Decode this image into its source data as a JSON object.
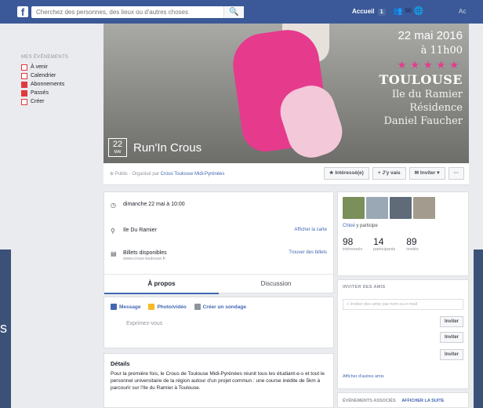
{
  "topbar": {
    "logo": "f",
    "search_placeholder": "Cherchez des personnes, des lieux ou d'autres choses",
    "search_icon": "🔍",
    "home_label": "Accueil",
    "home_badge": "1",
    "user_label": "Ac"
  },
  "leftnav": {
    "heading": "MES ÉVÉNEMENTS",
    "items": [
      {
        "label": "À venir"
      },
      {
        "label": "Calendrier"
      },
      {
        "label": "Abonnements"
      },
      {
        "label": "Passés"
      },
      {
        "label": "Créer"
      }
    ]
  },
  "cover": {
    "day": "22",
    "month": "MAI",
    "event_name": "Run'In Crous",
    "date_text": "22 mai 2016",
    "time_text": "à 11h00",
    "stars": "★★★★★",
    "city": "TOULOUSE",
    "place_lines": [
      "Ile du Ramier",
      "Résidence",
      "Daniel Faucher"
    ]
  },
  "actionbar": {
    "meta_prefix": "Public · Organisé par",
    "organizer": "Crous Toulouse Midi-Pyrénées",
    "interested": "★ Intéressé(e)",
    "going": "+ J'y vais",
    "invite": "✉ Inviter ▾",
    "more": "···"
  },
  "info": {
    "date": "dimanche 22 mai à 10:00",
    "place": "Ile Du Ramier",
    "place_link": "Afficher la carte",
    "tickets": "Billets disponibles",
    "tickets_sub": "www.crous-toulouse.fr",
    "tickets_link": "Trouver des billets"
  },
  "tabs": {
    "about": "À propos",
    "discussion": "Discussion"
  },
  "composer": {
    "message": "Message",
    "photo": "Photo/vidéo",
    "poll": "Créer un sondage",
    "placeholder": "Exprimez-vous"
  },
  "details": {
    "title": "Détails",
    "text": "Pour la première fois, le Crous de Toulouse Midi-Pyrénées réunit tous les étudiant-e-s et tout le personnel universitaire de la région autour d'un projet commun : une course inédite de 5km à parcourir sur l'Ile du Ramier à Toulouse."
  },
  "guests": {
    "participe_name": "Chloé",
    "participe_text": "y participe",
    "counts": [
      {
        "num": "98",
        "label": "intéressés"
      },
      {
        "num": "14",
        "label": "participants"
      },
      {
        "num": "89",
        "label": "invités"
      }
    ]
  },
  "invite": {
    "title": "INVITER DES AMIS",
    "placeholder": "+ Invitez des amis par nom ou e-mail",
    "button": "Inviter",
    "more": "Afficher d'autres amis"
  },
  "related": {
    "title": "ÉVÉNEMENTS ASSOCIÉS",
    "link": "AFFICHER LA SUITE"
  },
  "colors": {
    "brand": "#3b5998",
    "accent_pink": "#e63a8d",
    "link": "#4267b2"
  }
}
